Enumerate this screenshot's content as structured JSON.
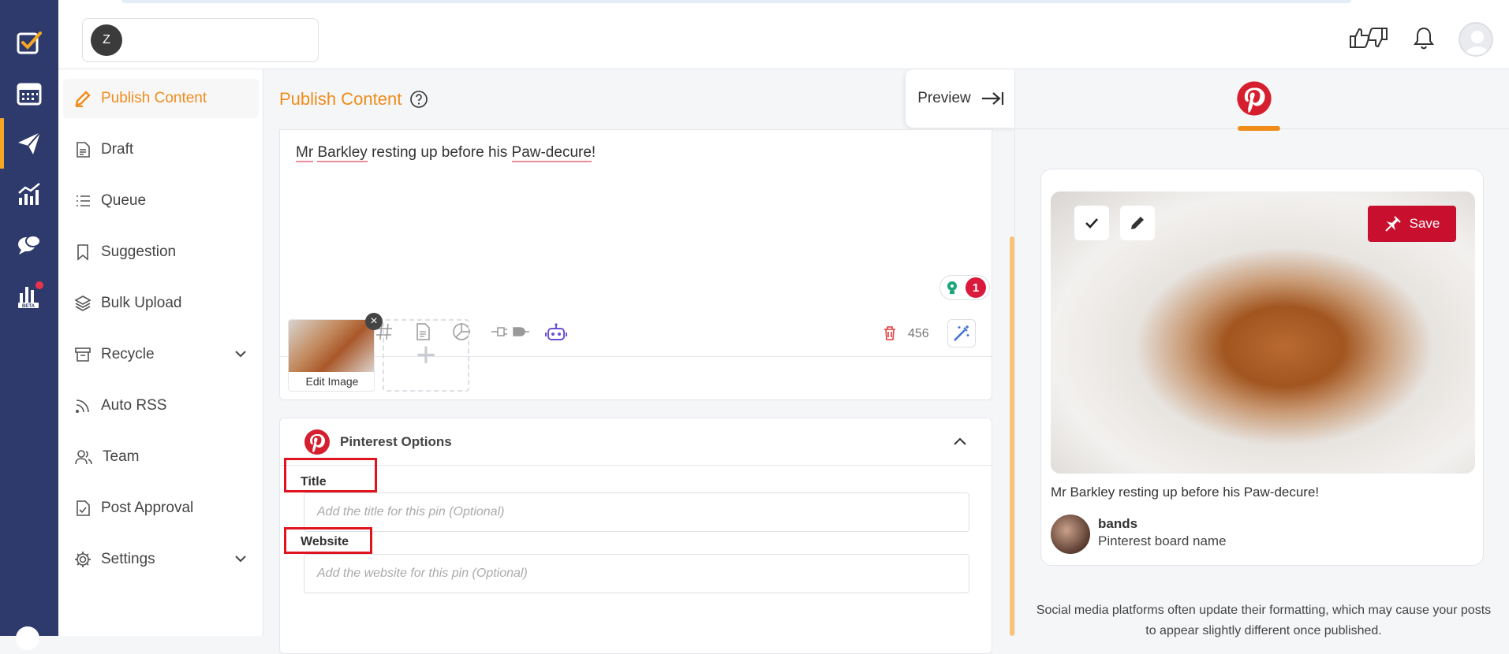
{
  "workspace": {
    "avatar_letter": "Z"
  },
  "rail": [
    {
      "name": "logo-icon"
    },
    {
      "name": "planner-icon"
    },
    {
      "name": "publish-icon"
    },
    {
      "name": "analytics-icon"
    },
    {
      "name": "inbox-icon"
    },
    {
      "name": "reports-beta-icon",
      "badge": "BETA"
    }
  ],
  "nav": {
    "items": [
      {
        "label": "Publish Content",
        "icon": "pencil-icon"
      },
      {
        "label": "Draft",
        "icon": "document-icon"
      },
      {
        "label": "Queue",
        "icon": "list-icon"
      },
      {
        "label": "Suggestion",
        "icon": "bookmark-icon"
      },
      {
        "label": "Bulk Upload",
        "icon": "layers-icon"
      },
      {
        "label": "Recycle",
        "icon": "archive-icon"
      },
      {
        "label": "Auto RSS",
        "icon": "rss-icon"
      },
      {
        "label": "Team",
        "icon": "users-icon"
      },
      {
        "label": "Post Approval",
        "icon": "approval-doc-icon"
      },
      {
        "label": "Settings",
        "icon": "gear-icon"
      }
    ]
  },
  "main": {
    "title": "Publish Content",
    "preview_label": "Preview",
    "composer": {
      "text_parts": [
        "Mr",
        " ",
        "Barkley",
        " resting up before his ",
        "Paw-decure",
        "!"
      ],
      "lint_count": "1",
      "char_count": "456"
    },
    "media": {
      "edit_label": "Edit Image",
      "close_glyph": "×",
      "add_glyph": "+"
    },
    "pinterest": {
      "section_title": "Pinterest Options",
      "title_label": "Title",
      "title_placeholder": "Add the title for this pin (Optional)",
      "website_label": "Website",
      "website_placeholder": "Add the website for this pin (Optional)"
    }
  },
  "preview": {
    "save_label": "Save",
    "caption": "Mr Barkley resting up before his Paw-decure!",
    "board_name": "bands",
    "board_sub": "Pinterest board name",
    "disclaimer": "Social media platforms often update their formatting, which may cause your posts to appear slightly different once published."
  },
  "colors": {
    "accent": "#f08c1a",
    "rail": "#2d3a6b",
    "pinterest_red": "#c8102e",
    "highlight_box": "#e0141e"
  }
}
